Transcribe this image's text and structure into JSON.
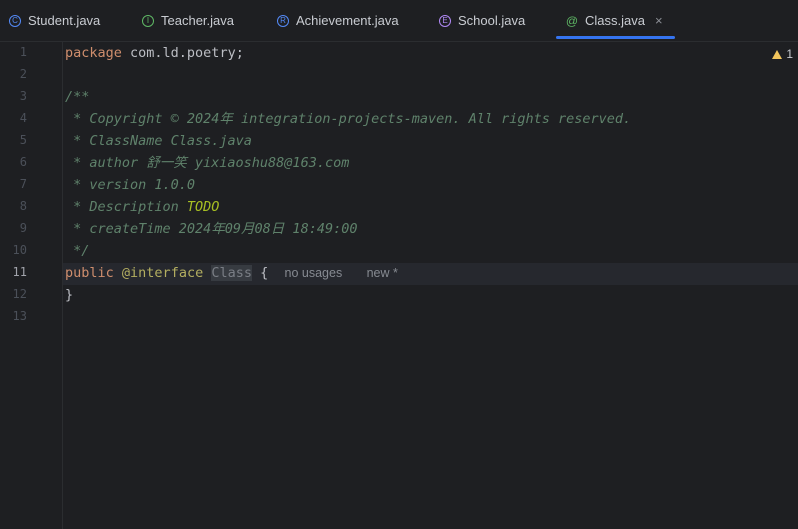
{
  "tabs": [
    {
      "label": "Student.java",
      "icon": "class-icon",
      "glyph": "C",
      "color": "#548af7"
    },
    {
      "label": "Teacher.java",
      "icon": "interface-icon",
      "glyph": "I",
      "color": "#5fb865"
    },
    {
      "label": "Achievement.java",
      "icon": "record-icon",
      "glyph": "R",
      "color": "#548af7"
    },
    {
      "label": "School.java",
      "icon": "enum-icon",
      "glyph": "E",
      "color": "#b189f5"
    },
    {
      "label": "Class.java",
      "icon": "annotation-icon",
      "glyph": "@",
      "color": "#5fb865",
      "active": true
    }
  ],
  "close_glyph": "×",
  "warnings": {
    "count": "1"
  },
  "line_numbers": [
    "1",
    "2",
    "3",
    "4",
    "5",
    "6",
    "7",
    "8",
    "9",
    "10",
    "11",
    "12",
    "13"
  ],
  "current_line": "11",
  "code": {
    "l1_kw": "package",
    "l1_rest": " com.ld.poetry;",
    "l3": "/**",
    "l4": " * Copyright © 2024年 integration-projects-maven. All rights reserved.",
    "l5": " * ClassName Class.java",
    "l6": " * author 舒一笑 yixiaoshu88@163.com",
    "l7": " * version 1.0.0",
    "l8_pre": " * Description ",
    "l8_todo": "TODO",
    "l9": " * createTime 2024年09月08日 18:49:00",
    "l10": " */",
    "l11_kw": "public",
    "l11_ann": "@interface",
    "l11_cls": "Class",
    "l11_brace": "{",
    "hint_usages": "no usages",
    "hint_new": "new *",
    "l12": "}"
  }
}
